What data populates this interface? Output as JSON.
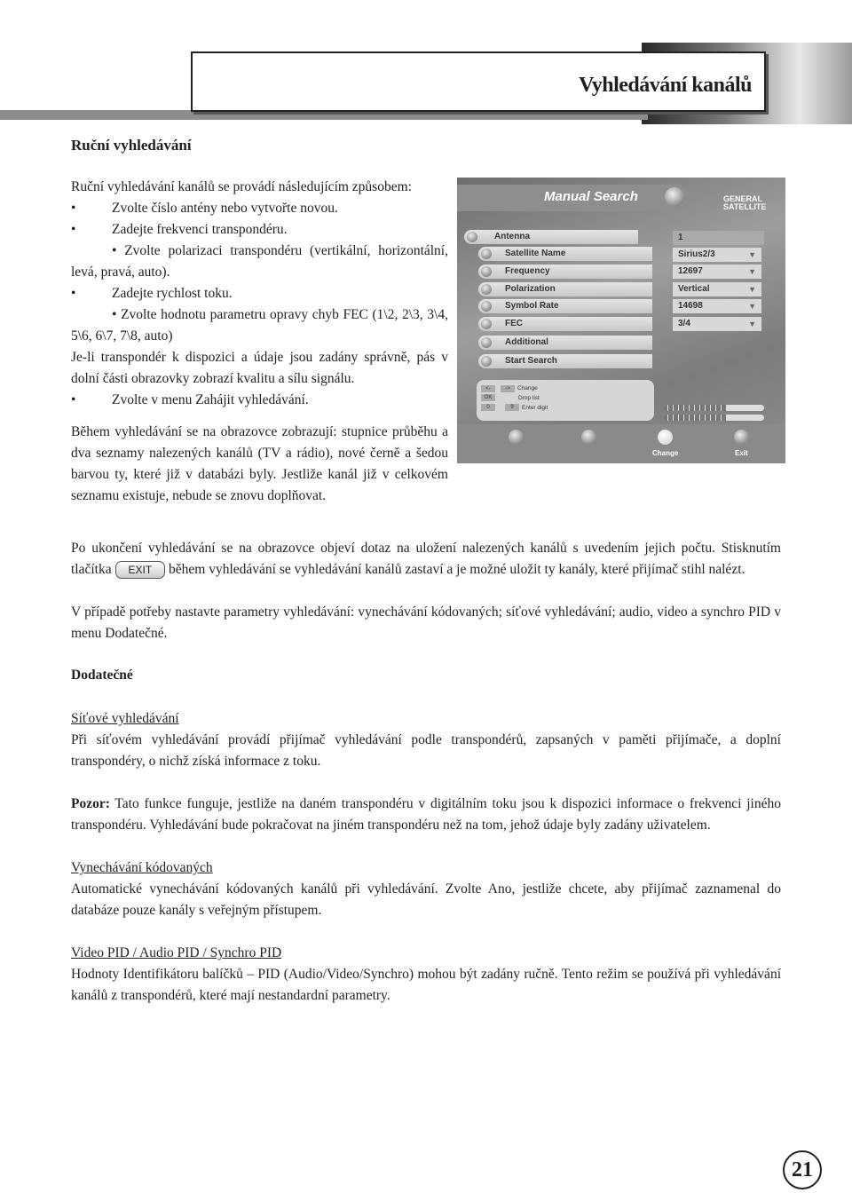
{
  "header": {
    "title": "Vyhledávání kanálů"
  },
  "section1": {
    "heading": "Ruční vyhledávání",
    "intro": "Ruční vyhledávání kanálů se provádí následujícím způsobem:",
    "bullets": [
      "Zvolte číslo antény nebo vytvořte novou.",
      "Zadejte frekvenci transpondéru.",
      "Zvolte polarizaci transpondéru (vertikální, horizontální, levá, pravá, auto).",
      "Zadejte rychlost toku.",
      "Zvolte hodnotu parametru opravy chyb FEC (1\\2, 2\\3, 3\\4, 5\\6, 6\\7, 7\\8, auto)"
    ],
    "para": "Je-li transpondér k dispozici a údaje jsou zadány správně, pás v dolní části obrazovky zobrazí kvalitu a sílu signálu.",
    "bullet_last": "Zvolte v menu Zahájit vyhledávání.",
    "para2": "Během vyhledávání se na obrazovce zobrazují: stupnice průběhu a dva seznamy nalezených kanálů (TV a rádio), nové černě a šedou barvou ty, které již v databázi byly. Jestliže kanál již v celkovém seznamu existuje, nebude se znovu doplňovat."
  },
  "screen": {
    "title": "Manual Search",
    "logo": [
      "GENERAL",
      "SATELLITE"
    ],
    "rows": [
      "Antenna",
      "Satellite Name",
      "Frequency",
      "Polarization",
      "Symbol Rate",
      "FEC",
      "Additional",
      "Start Search"
    ],
    "values": [
      "1",
      "Sirius2/3",
      "12697",
      "Vertical",
      "14698",
      "3/4"
    ],
    "help": {
      "keys": [
        "<-",
        "->",
        "OK",
        "0",
        "9"
      ],
      "change": "Change",
      "drop": "Drop list",
      "enter": "Enter digit"
    },
    "signal_quality": 0.62,
    "signal_strength": 0.62,
    "footer": {
      "change": "Change",
      "exit": "Exit"
    }
  },
  "para3a": "Po ukončení vyhledávání se na obrazovce objeví dotaz na uložení nalezených kanálů s uvedením jejich počtu. Stisknutím tlačítka",
  "exit_button": "EXIT",
  "para3b": "během vyhledávání se vyhledávání kanálů zastaví a je možné uložit ty kanály, které přijímač stihl nalézt.",
  "para4": "V případě potřeby nastavte parametry vyhledávání: vynechávání kódovaných; síťové vyhledávání; audio, video a synchro PID v menu Dodatečné.",
  "section2": {
    "heading": "Dodatečné",
    "net": {
      "title": "Síťové vyhledávání",
      "text": "Při síťovém vyhledávání provádí přijímač vyhledávání podle transpondérů, zapsaných v paměti přijímače, a doplní transpondéry, o nichž získá informace z toku."
    },
    "note": {
      "label": "Pozor:",
      "text": "Tato funkce funguje, jestliže na daném transpondéru v digitálním toku jsou k dispozici informace o frekvenci jiného transpondéru. Vyhledávání bude pokračovat na jiném transpondéru než na tom, jehož údaje byly zadány uživatelem."
    },
    "skip": {
      "title": "Vynechávání kódovaných",
      "text": "Automatické vynechávání kódovaných kanálů při vyhledávání. Zvolte Ano, jestliže chcete, aby přijímač zaznamenal do databáze pouze kanály s veřejným přístupem."
    },
    "pid": {
      "title": "Video PID / Audio PID / Synchro PID",
      "text": "Hodnoty Identifikátoru balíčků – PID (Audio/Video/Synchro) mohou být zadány ručně. Tento režim se používá při vyhledávání kanálů z transpondérů, které mají nestandardní parametry."
    }
  },
  "page_number": "21"
}
